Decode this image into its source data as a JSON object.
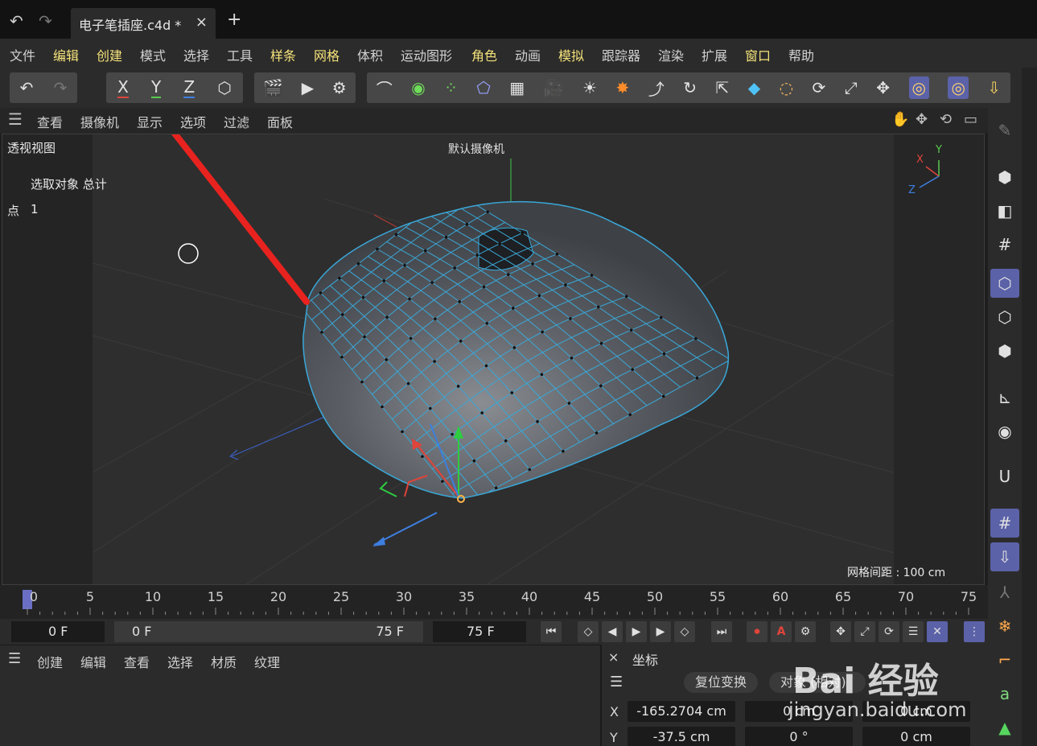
{
  "titlebar": {
    "undo_icon": "undo-icon",
    "redo_icon": "redo-icon",
    "doc_tab": "电子笔插座.c4d *",
    "close_glyph": "×",
    "new_tab_glyph": "+"
  },
  "menubar": [
    {
      "label": "文件",
      "highlight": false
    },
    {
      "label": "编辑",
      "highlight": true
    },
    {
      "label": "创建",
      "highlight": true
    },
    {
      "label": "模式",
      "highlight": false
    },
    {
      "label": "选择",
      "highlight": false
    },
    {
      "label": "工具",
      "highlight": false
    },
    {
      "label": "样条",
      "highlight": true
    },
    {
      "label": "网格",
      "highlight": true
    },
    {
      "label": "体积",
      "highlight": false
    },
    {
      "label": "运动图形",
      "highlight": false
    },
    {
      "label": "角色",
      "highlight": true
    },
    {
      "label": "动画",
      "highlight": false
    },
    {
      "label": "模拟",
      "highlight": true
    },
    {
      "label": "跟踪器",
      "highlight": false
    },
    {
      "label": "渲染",
      "highlight": false
    },
    {
      "label": "扩展",
      "highlight": false
    },
    {
      "label": "窗口",
      "highlight": true
    },
    {
      "label": "帮助",
      "highlight": false
    }
  ],
  "toolbar": {
    "axis_x": "X",
    "axis_y": "Y",
    "axis_z": "Z",
    "axis_colors": {
      "x": "#e0443a",
      "y": "#58c94f",
      "z": "#3d7fe0"
    }
  },
  "viewport_menu": [
    "查看",
    "摄像机",
    "显示",
    "选项",
    "过滤",
    "面板"
  ],
  "viewport": {
    "view_name": "透视视图",
    "camera_name": "默认摄像机",
    "selection_header": "选取对象 总计",
    "point_label": "点",
    "point_count": "1",
    "grid_spacing": "网格间距 : 100 cm",
    "axis_gizmo": {
      "x": "X",
      "y": "Y",
      "z": "Z"
    },
    "wire_color": "#3aa7d8",
    "mesh_color": "#5c6168"
  },
  "timeline": {
    "ticks": [
      "0",
      "5",
      "10",
      "15",
      "20",
      "25",
      "30",
      "35",
      "40",
      "45",
      "50",
      "55",
      "60",
      "65",
      "70",
      "75"
    ],
    "current_frame": 0
  },
  "time_controls": {
    "current": "0 F",
    "range_start": "0 F",
    "range_end": "75 F",
    "end": "75 F",
    "record_label": "A"
  },
  "material_panel": {
    "menu": [
      "创建",
      "编辑",
      "查看",
      "选择",
      "材质",
      "纹理"
    ]
  },
  "coordinates_panel": {
    "title": "坐标",
    "close_glyph": "×",
    "reset_button": "复位变换",
    "mode_button": "对象 (相对)",
    "rows": [
      {
        "axis": "X",
        "pos": "-165.2704 cm",
        "size": "0 cm",
        "rot": "0 cm"
      },
      {
        "axis": "Y",
        "pos": "-37.5 cm",
        "size": "0 °",
        "rot": "0 cm"
      }
    ]
  },
  "watermark": {
    "main": "Bai 经验",
    "sub": "jingyan.baidu.com"
  }
}
